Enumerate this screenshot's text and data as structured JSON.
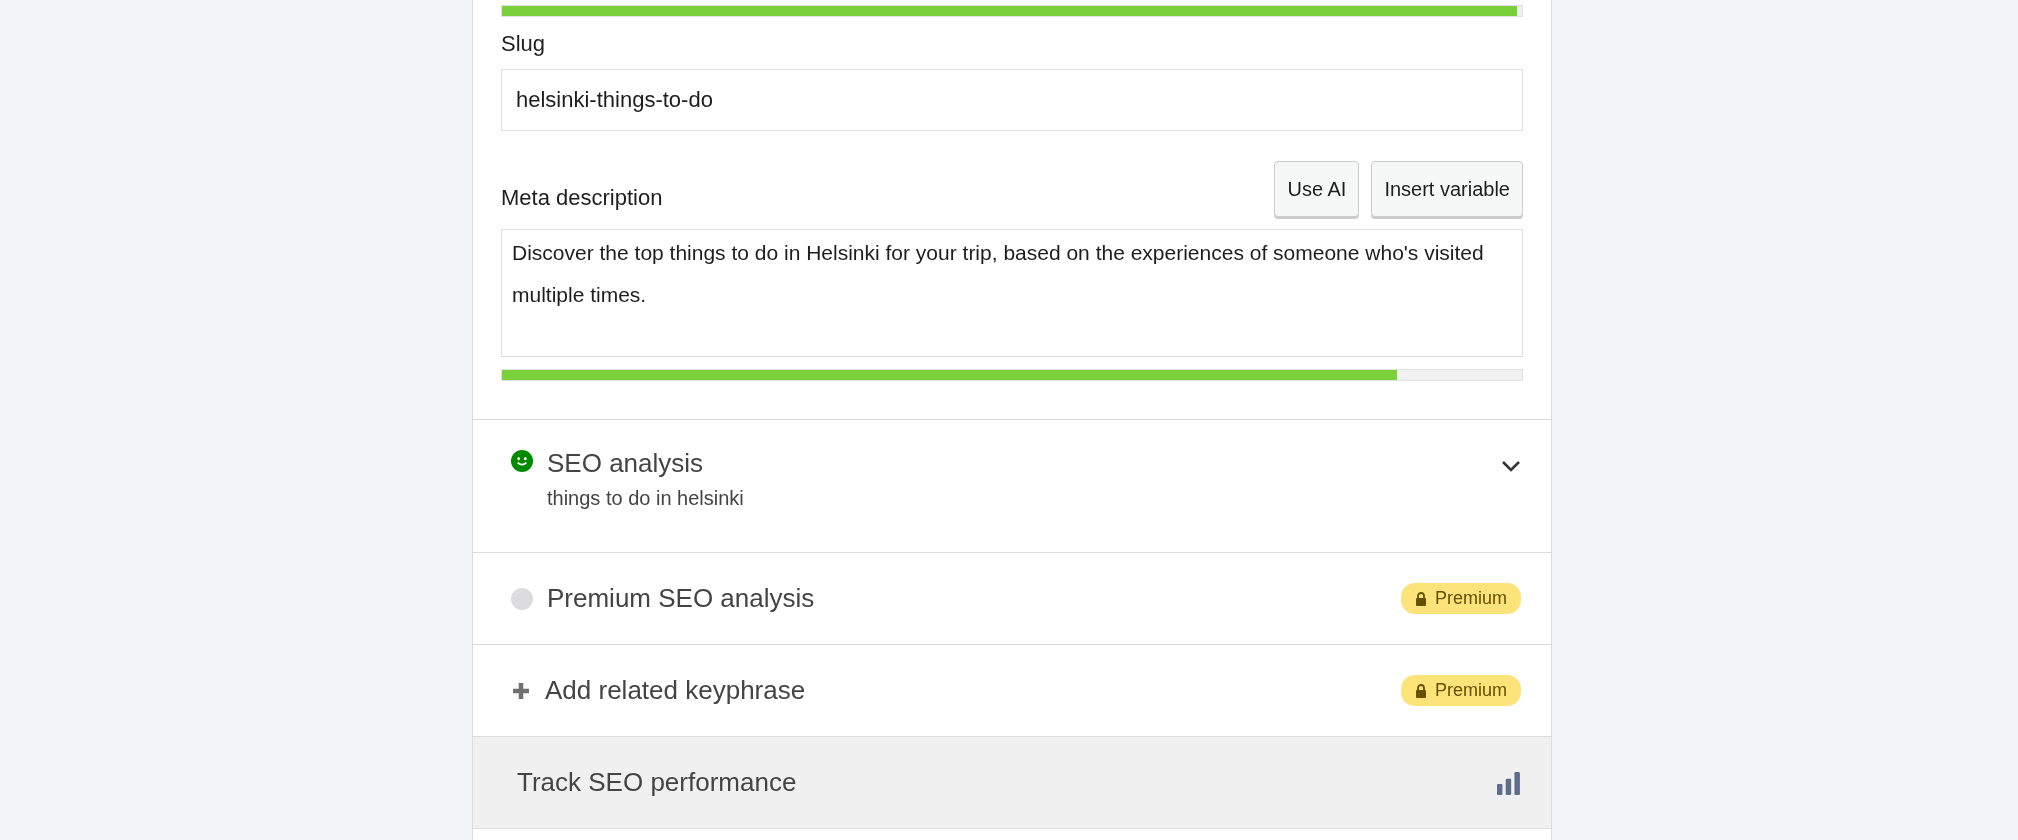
{
  "title_meter": {
    "level": 0.995
  },
  "slug": {
    "label": "Slug",
    "value": "helsinki-things-to-do"
  },
  "meta_description": {
    "label": "Meta description",
    "buttons": [
      "Use AI",
      "Insert variable"
    ],
    "value": "Discover the top things to do in Helsinki for your trip, based on the experiences of someone who's visited multiple times.",
    "meter": {
      "level": 0.877
    }
  },
  "sections": [
    {
      "kind": "analysis",
      "title": "SEO analysis",
      "subtitle": "things to do in helsinki"
    },
    {
      "kind": "premium",
      "title": "Premium SEO analysis",
      "badge": "Premium"
    },
    {
      "kind": "related",
      "title": "Add related keyphrase",
      "badge": "Premium"
    },
    {
      "kind": "track",
      "title": "Track SEO performance"
    }
  ]
}
